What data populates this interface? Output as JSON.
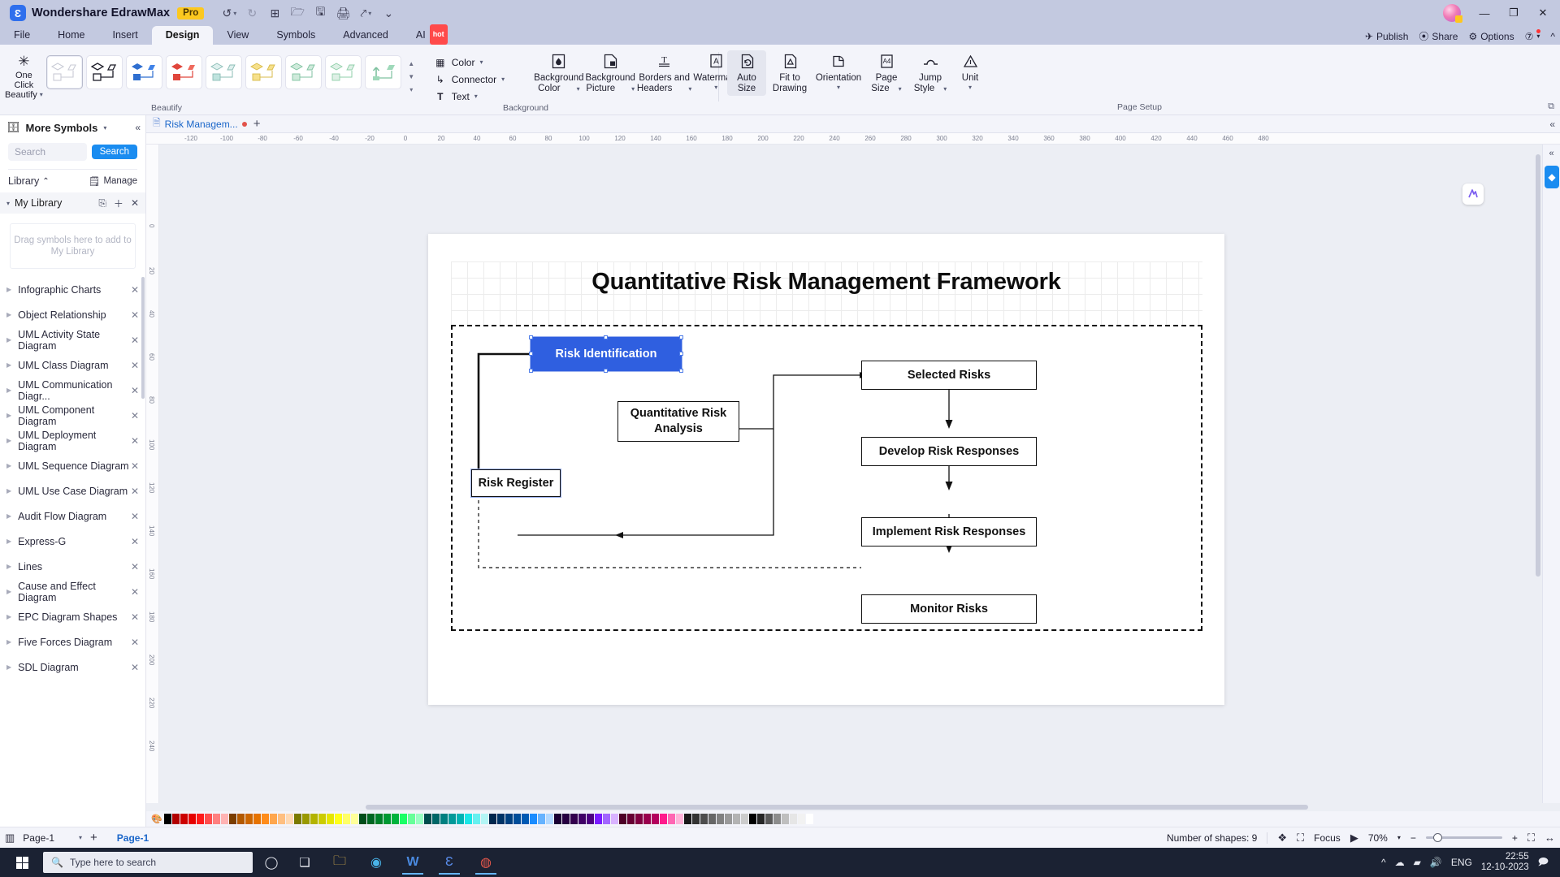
{
  "titlebar": {
    "app_name": "Wondershare EdrawMax",
    "pro_badge": "Pro",
    "quick_access": [
      {
        "name": "undo-icon",
        "glyph": "↺",
        "caret": true,
        "dim": false
      },
      {
        "name": "redo-icon",
        "glyph": "↻",
        "caret": false,
        "dim": true
      },
      {
        "name": "new-icon",
        "glyph": "⊞",
        "caret": false,
        "dim": false
      },
      {
        "name": "open-icon",
        "glyph": "🗁",
        "caret": false,
        "dim": false
      },
      {
        "name": "save-icon",
        "glyph": "🖫",
        "caret": false,
        "dim": false
      },
      {
        "name": "print-icon",
        "glyph": "🖨",
        "caret": false,
        "dim": false
      },
      {
        "name": "export-icon",
        "glyph": "⤤",
        "caret": true,
        "dim": false
      },
      {
        "name": "more-icon",
        "glyph": "⌄",
        "caret": false,
        "dim": false
      }
    ],
    "window_controls": [
      "−",
      "❐",
      "✕"
    ]
  },
  "menubar": {
    "tabs": [
      {
        "label": "File",
        "active": false
      },
      {
        "label": "Home",
        "active": false
      },
      {
        "label": "Insert",
        "active": false
      },
      {
        "label": "Design",
        "active": true
      },
      {
        "label": "View",
        "active": false
      },
      {
        "label": "Symbols",
        "active": false
      },
      {
        "label": "Advanced",
        "active": false
      }
    ],
    "ai_label": "AI",
    "ai_hot": "hot",
    "right": [
      {
        "label": "Publish",
        "icon": "publish-icon",
        "glyph": "✈"
      },
      {
        "label": "Share",
        "icon": "share-icon",
        "glyph": "⦿"
      },
      {
        "label": "Options",
        "icon": "gear-icon",
        "glyph": "⚙"
      }
    ],
    "help_glyph": "?",
    "collapse_glyph": "^"
  },
  "ribbon": {
    "one_click": {
      "line1": "One Click",
      "line2": "Beautify",
      "icon": "sparkle-icon",
      "glyph": "✳"
    },
    "beautify_group_label": "Beautify",
    "style_cards": [
      {
        "name": "style-outline-plain",
        "selected": true
      },
      {
        "name": "style-outline-bold",
        "selected": false
      },
      {
        "name": "style-blue",
        "selected": false
      },
      {
        "name": "style-red",
        "selected": false
      },
      {
        "name": "style-teal",
        "selected": false
      },
      {
        "name": "style-yellow",
        "selected": false
      },
      {
        "name": "style-green",
        "selected": false
      },
      {
        "name": "style-green-alt",
        "selected": false
      },
      {
        "name": "style-arrow-green",
        "selected": false
      }
    ],
    "mini_buttons": [
      {
        "label": "Color",
        "icon": "color-grid-icon",
        "glyph": "▦",
        "caret": true
      },
      {
        "label": "Connector",
        "icon": "connector-icon",
        "glyph": "⌐",
        "caret": true
      },
      {
        "label": "Text",
        "icon": "text-icon",
        "glyph": "T",
        "caret": true
      }
    ],
    "background_group_label": "Background",
    "background_buttons": [
      {
        "label1": "Background",
        "label2": "Color",
        "icon": "background-color-icon",
        "glyph": "◧",
        "caret": true
      },
      {
        "label1": "Background",
        "label2": "Picture",
        "icon": "background-picture-icon",
        "glyph": "🖼",
        "caret": true
      },
      {
        "label1": "Borders and",
        "label2": "Headers",
        "icon": "borders-headers-icon",
        "glyph": "T̲",
        "caret": true
      },
      {
        "label1": "Watermark",
        "label2": "",
        "icon": "watermark-icon",
        "glyph": "A",
        "caret": true
      }
    ],
    "page_setup_group_label": "Page Setup",
    "page_buttons": [
      {
        "label1": "Auto",
        "label2": "Size",
        "icon": "auto-size-icon",
        "glyph": "⤢",
        "caret": false,
        "active": true
      },
      {
        "label1": "Fit to",
        "label2": "Drawing",
        "icon": "fit-to-drawing-icon",
        "glyph": "⌂",
        "caret": false,
        "active": false
      },
      {
        "label1": "Orientation",
        "label2": "",
        "icon": "orientation-icon",
        "glyph": "⊿",
        "caret": true,
        "active": false
      },
      {
        "label1": "Page",
        "label2": "Size",
        "icon": "page-size-icon",
        "glyph": "A4",
        "caret": true,
        "active": false
      },
      {
        "label1": "Jump",
        "label2": "Style",
        "icon": "jump-style-icon",
        "glyph": "∧",
        "caret": true,
        "active": false
      },
      {
        "label1": "Unit",
        "label2": "",
        "icon": "unit-icon",
        "glyph": "△",
        "caret": true,
        "active": false
      }
    ],
    "expand_glyph": "⧉"
  },
  "left_panel": {
    "header_title": "More Symbols",
    "header_icon": "symbols-library-icon",
    "header_caret": "▾",
    "collapse_glyph": "«",
    "search_placeholder": "Search",
    "search_button": "Search",
    "library_label": "Library",
    "library_collapse_glyph": "⌃",
    "manage_label": "Manage",
    "manage_icon": "manage-icon",
    "my_library_label": "My Library",
    "my_library_actions": [
      "import-icon",
      "add-icon",
      "close-icon"
    ],
    "dropzone_text": "Drag symbols here to add to My Library",
    "categories": [
      "Infographic Charts",
      "Object Relationship",
      "UML Activity State Diagram",
      "UML Class Diagram",
      "UML Communication Diagr...",
      "UML Component Diagram",
      "UML Deployment Diagram",
      "UML Sequence Diagram",
      "UML Use Case Diagram",
      "Audit Flow Diagram",
      "Express-G",
      "Lines",
      "Cause and Effect Diagram",
      "EPC Diagram Shapes",
      "Five Forces Diagram",
      "SDL Diagram"
    ]
  },
  "doc_tabs": {
    "active_tab": "Risk Managem...",
    "modified_dot": true,
    "new_tab_glyph": "+",
    "right_collapse_glyph": "«"
  },
  "rulers": {
    "horizontal": [
      "-120",
      "-100",
      "-80",
      "-60",
      "-40",
      "-20",
      "0",
      "20",
      "40",
      "60",
      "80",
      "100",
      "120",
      "140",
      "160",
      "180",
      "200",
      "220",
      "240",
      "260",
      "280",
      "300",
      "320",
      "340",
      "360",
      "380",
      "400",
      "420",
      "440",
      "460",
      "480"
    ],
    "vertical": [
      "0",
      "20",
      "40",
      "60",
      "80",
      "100",
      "120",
      "140",
      "160",
      "180",
      "200",
      "220",
      "240"
    ]
  },
  "diagram": {
    "title": "Quantitative Risk Management Framework",
    "nodes": [
      {
        "id": "risk-identification",
        "label": "Risk Identification",
        "selected": true
      },
      {
        "id": "quantitative-risk-analysis",
        "label": "Quantitative Risk Analysis",
        "selected": false
      },
      {
        "id": "risk-register",
        "label": "Risk Register",
        "selected": false
      },
      {
        "id": "selected-risks",
        "label": "Selected Risks",
        "selected": false
      },
      {
        "id": "develop-risk-responses",
        "label": "Develop Risk Responses",
        "selected": false
      },
      {
        "id": "implement-risk-responses",
        "label": "Implement Risk Responses",
        "selected": false
      },
      {
        "id": "monitor-risks",
        "label": "Monitor Risks",
        "selected": false
      }
    ],
    "watermark_glyph": "Ⓐ"
  },
  "palette": {
    "more_icon": "palette-picker-icon",
    "colors": [
      "#000000",
      "#b20000",
      "#cc0000",
      "#e60000",
      "#ff1a1a",
      "#ff4d4d",
      "#ff8080",
      "#ffb3b3",
      "#7a3d00",
      "#b35900",
      "#cc6600",
      "#e67300",
      "#ff8c1a",
      "#ffa64d",
      "#ffbf80",
      "#ffd9b3",
      "#7a7a00",
      "#999900",
      "#b3b300",
      "#cccc00",
      "#e6e600",
      "#ffff1a",
      "#ffff66",
      "#ffff99",
      "#004d1a",
      "#006622",
      "#008029",
      "#009933",
      "#00b33c",
      "#1aff66",
      "#66ff99",
      "#99ffc2",
      "#004d4d",
      "#006666",
      "#008080",
      "#009999",
      "#00b3b3",
      "#1ae6e6",
      "#66f0f0",
      "#b3f5f5",
      "#00264d",
      "#003366",
      "#004080",
      "#004d99",
      "#0059b3",
      "#1a8cff",
      "#66b3ff",
      "#b3d9ff",
      "#1a0033",
      "#260040",
      "#33004d",
      "#400066",
      "#4d0080",
      "#7a1aff",
      "#a366ff",
      "#d9b3ff",
      "#4d0026",
      "#660033",
      "#800040",
      "#99004d",
      "#b3005c",
      "#ff1a8c",
      "#ff66b3",
      "#ffb3d9",
      "#1a1a1a",
      "#333333",
      "#4d4d4d",
      "#666666",
      "#808080",
      "#999999",
      "#b3b3b3",
      "#cccccc",
      "#000000",
      "#262626",
      "#595959",
      "#8c8c8c",
      "#bfbfbf",
      "#e6e6e6",
      "#f2f2f2",
      "#ffffff"
    ]
  },
  "status_bar": {
    "layout_icon": "page-layout-icon",
    "page_name": "Page-1",
    "page_caret": "▾",
    "add_page_glyph": "+",
    "page_tab": "Page-1",
    "shapes_label": "Number of shapes: 9",
    "layers_icon": "layers-icon",
    "focus_icon": "focus-icon",
    "focus_label": "Focus",
    "presentation_icon": "presentation-icon",
    "zoom_value": "70%",
    "zoom_caret": "▾",
    "zoom_out": "−",
    "zoom_in": "+",
    "fit_icon": "fit-screen-icon",
    "width_icon": "fit-width-icon"
  },
  "taskbar": {
    "search_placeholder": "Type here to search",
    "search_icon": "search-icon",
    "buttons": [
      {
        "name": "cortana-icon",
        "glyph": "◯"
      },
      {
        "name": "task-view-icon",
        "glyph": "❏"
      }
    ],
    "apps": [
      {
        "name": "file-explorer-icon",
        "glyph": "🗀",
        "active": false
      },
      {
        "name": "edge-icon",
        "glyph": "◉",
        "active": false
      },
      {
        "name": "word-icon",
        "glyph": "W",
        "active": true
      },
      {
        "name": "edrawmax-icon",
        "glyph": "Ɛ",
        "active": true
      },
      {
        "name": "chrome-icon",
        "glyph": "◍",
        "active": true
      }
    ],
    "tray": [
      {
        "name": "show-hidden-icons",
        "glyph": "^"
      },
      {
        "name": "onedrive-icon",
        "glyph": "☁"
      },
      {
        "name": "network-icon",
        "glyph": "📶"
      },
      {
        "name": "volume-icon",
        "glyph": "🔊"
      }
    ],
    "language": "ENG",
    "time": "22:55",
    "date": "12-10-2023",
    "notification_glyph": "🗩"
  }
}
